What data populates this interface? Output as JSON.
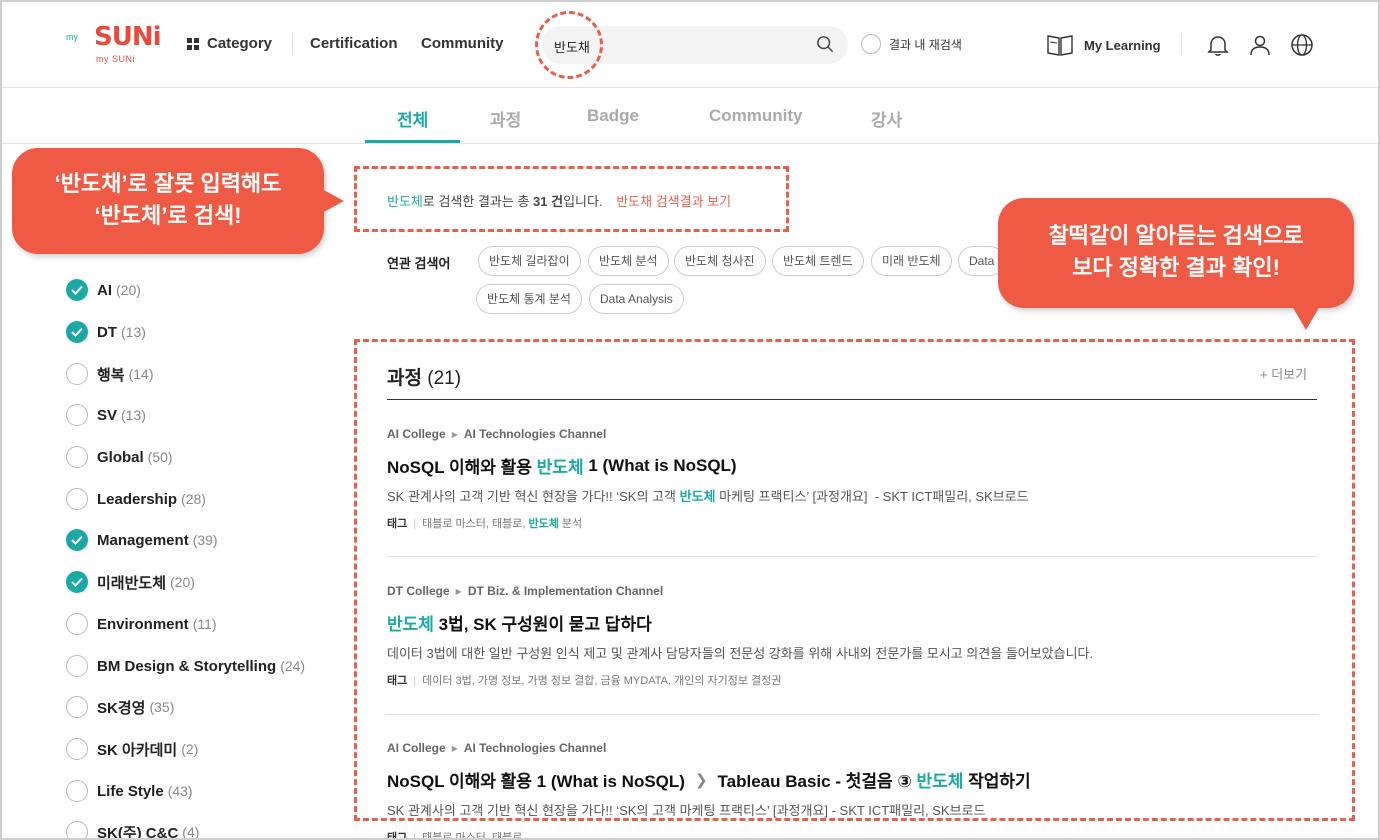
{
  "header": {
    "logo_main": "SUNi",
    "logo_my": "my",
    "logo_sub": "my SUNi",
    "category_label": "Category",
    "certification_label": "Certification",
    "community_label": "Community",
    "search_value": "반도채",
    "research_label": "결과 내 재검색",
    "mylearning_label": "My Learning"
  },
  "tabs": [
    {
      "label": "전체",
      "active": true
    },
    {
      "label": "과정",
      "active": false
    },
    {
      "label": "Badge",
      "active": false
    },
    {
      "label": "Community",
      "active": false
    },
    {
      "label": "강사",
      "active": false
    }
  ],
  "callouts": {
    "left_line1": "‘반도채’로 잘못 입력해도",
    "left_line2": "‘반도체’로 검색!",
    "right_line1": "찰떡같이 알아듣는 검색으로",
    "right_line2": "보다 정확한 결과 확인!"
  },
  "summary": {
    "keyword": "반도체",
    "text_mid": "로 검색한 결과는 총 ",
    "count": "31 건",
    "text_end": "입니다.",
    "link": "반도채 검색결과 보기"
  },
  "related": {
    "label": "연관 검색어",
    "chips": [
      "반도체 길라잡이",
      "반도체 분석",
      "반도체 청사진",
      "반도체 트렌드",
      "미래 반도체",
      "Data",
      "반도체 통계 분석",
      "Data Analysis"
    ]
  },
  "categories": [
    {
      "name": "AI",
      "count": "(20)",
      "checked": true
    },
    {
      "name": "DT",
      "count": "(13)",
      "checked": true
    },
    {
      "name": "행복",
      "count": "(14)",
      "checked": false
    },
    {
      "name": "SV",
      "count": "(13)",
      "checked": false
    },
    {
      "name": "Global",
      "count": "(50)",
      "checked": false
    },
    {
      "name": "Leadership",
      "count": "(28)",
      "checked": false
    },
    {
      "name": "Management",
      "count": "(39)",
      "checked": true
    },
    {
      "name": "미래반도체",
      "count": "(20)",
      "checked": true
    },
    {
      "name": "Environment",
      "count": "(11)",
      "checked": false
    },
    {
      "name": "BM Design & Storytelling",
      "count": "(24)",
      "checked": false
    },
    {
      "name": "SK경영",
      "count": "(35)",
      "checked": false
    },
    {
      "name": "SK 아카데미",
      "count": "(2)",
      "checked": false
    },
    {
      "name": "Life Style",
      "count": "(43)",
      "checked": false
    },
    {
      "name": "SK(주) C&C",
      "count": "(4)",
      "checked": false
    }
  ],
  "section": {
    "title": "과정",
    "count": "(21)",
    "more": "+ 더보기"
  },
  "results": [
    {
      "college": "AI College",
      "channel": "AI Technologies Channel",
      "title_pre": "NoSQL 이해와 활용 ",
      "title_hl": "반도체",
      "title_post": " 1 (What is NoSQL)",
      "desc_pre": "SK 관계사의 고객 기반 혁신 현장을 가다!! ‘SK의 고객 ",
      "desc_hl": "반도체",
      "desc_post": " 마케팅 프랙티스’ [과정개요]  - SKT ICT패밀리, SK브로드",
      "tag_label": "태그",
      "tags_pre": "태블로 마스터, 태블로, ",
      "tags_hl": "반도체",
      "tags_post": " 분석"
    },
    {
      "college": "DT College",
      "channel": "DT Biz. & Implementation Channel",
      "title_hl": "반도체",
      "title_post": " 3법, SK 구성원이 묻고 답하다",
      "desc": "데이터 3법에 대한 일반 구성원 인식 제고 및 관계사 담당자들의 전문성 강화를 위해 사내외 전문가를 모시고 의견을 들어보았습니다.",
      "tag_label": "태그",
      "tags": "데이터 3법, 가명 정보, 가명 정보 결합, 금융 MYDATA, 개인의 자기정보 결정권"
    },
    {
      "college": "AI College",
      "channel": "AI Technologies Channel",
      "title_a": "NoSQL 이해와 활용 1 (What is NoSQL)",
      "title_b_pre": "Tableau Basic - 첫걸음 ③ ",
      "title_b_hl": "반도체",
      "title_b_post": " 작업하기",
      "desc": "SK 관계사의 고객 기반 혁신 현장을 가다!! ‘SK의 고객 마케팅 프랙티스’ [과정개요]  - SKT ICT패밀리, SK브로드",
      "tag_label": "태그",
      "tags": "태블로 마스터, 태블로"
    }
  ]
}
